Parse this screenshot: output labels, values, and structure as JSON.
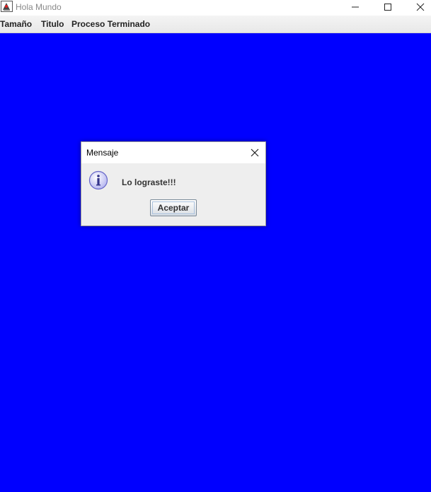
{
  "window": {
    "title": "Hola Mundo",
    "app_icon": "java-duke-icon",
    "controls": [
      "minimize-icon",
      "maximize-icon",
      "close-icon"
    ]
  },
  "menubar": {
    "items": [
      {
        "label": "Tamaño"
      },
      {
        "label": "Titulo"
      },
      {
        "label": "Proceso Terminado"
      }
    ]
  },
  "content": {
    "background_color": "#0000ff"
  },
  "dialog": {
    "title": "Mensaje",
    "icon": "information-icon",
    "message": "Lo lograste!!!",
    "ok_label": "Aceptar"
  }
}
